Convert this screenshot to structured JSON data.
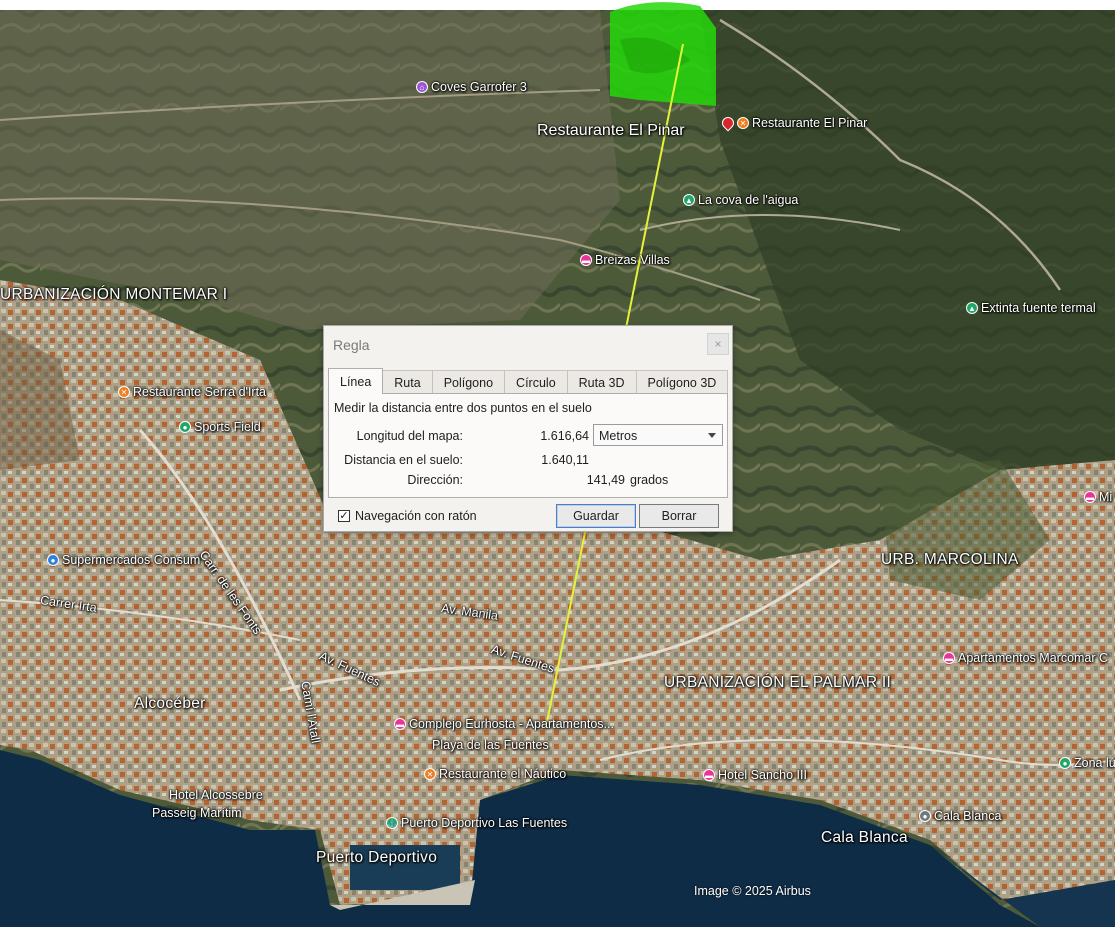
{
  "map": {
    "credit": "Image © 2025 Airbus",
    "colors": {
      "measure_line": "#e5f23a",
      "highlight_area": "#25d80a",
      "sea": "#0f2c46"
    },
    "labels": [
      {
        "id": "coves-garrofer",
        "text": "Coves Garrofer 3",
        "pin": "purple"
      },
      {
        "id": "restaurante-el-pinar-big",
        "text": "Restaurante El Pinar",
        "pin": ""
      },
      {
        "id": "restaurante-el-pinar",
        "text": "Restaurante El Pinar",
        "pin": "orange"
      },
      {
        "id": "cova-laigua",
        "text": "La cova de l'aigua",
        "pin": "green"
      },
      {
        "id": "breizas-villas",
        "text": "Breizas Villas",
        "pin": "pink"
      },
      {
        "id": "urb-montemar",
        "text": "URBANIZACIÓN MONTEMAR I",
        "pin": ""
      },
      {
        "id": "extinta-fuente",
        "text": "Extinta fuente termal",
        "pin": "green"
      },
      {
        "id": "restaurante-serra",
        "text": "Restaurante Serra d'Irta",
        "pin": "orange"
      },
      {
        "id": "sports-field",
        "text": "Sports Field",
        "pin": "green"
      },
      {
        "id": "supermercados",
        "text": "Supermercados Consum",
        "pin": "blue"
      },
      {
        "id": "carrer-fonts",
        "text": "Carr. de les Fonts",
        "pin": ""
      },
      {
        "id": "carrer-irta",
        "text": "Carrer Irta",
        "pin": ""
      },
      {
        "id": "av-manila",
        "text": "Av. Manila",
        "pin": ""
      },
      {
        "id": "av-fuentes-1",
        "text": "Av. Fuentes",
        "pin": ""
      },
      {
        "id": "av-fuentes-2",
        "text": "Av. Fuentes",
        "pin": ""
      },
      {
        "id": "urb-marcolina",
        "text": "URB. MARCOLINA",
        "pin": ""
      },
      {
        "id": "urb-palmar",
        "text": "URBANIZACIÓN EL PALMAR II",
        "pin": ""
      },
      {
        "id": "alcoceber",
        "text": "Alcocéber",
        "pin": ""
      },
      {
        "id": "cami-atall",
        "text": "Camí l'Atall",
        "pin": ""
      },
      {
        "id": "complejo",
        "text": "Complejo Eurhosta - Apartamentos...",
        "pin": "pink"
      },
      {
        "id": "playa-fuentes",
        "text": "Playa de las Fuentes",
        "pin": ""
      },
      {
        "id": "apart-marcomar",
        "text": "Apartamentos Marcomar C",
        "pin": "pink"
      },
      {
        "id": "restaurante-nautico",
        "text": "Restaurante el Náutico",
        "pin": "orange"
      },
      {
        "id": "hotel-sancho",
        "text": "Hotel Sancho III",
        "pin": "pink"
      },
      {
        "id": "zona-l",
        "text": "Zona lú",
        "pin": "green"
      },
      {
        "id": "hotel-alcossebre",
        "text": "Hotel Alcossebre",
        "pin": ""
      },
      {
        "id": "passeig",
        "text": "Passeig Marítim",
        "pin": ""
      },
      {
        "id": "puerto-fuentes",
        "text": "Puerto Deportivo Las Fuentes",
        "pin": "green"
      },
      {
        "id": "cala-blanca-pin",
        "text": "Cala Blanca",
        "pin": "grey"
      },
      {
        "id": "cala-blanca",
        "text": "Cala Blanca",
        "pin": ""
      },
      {
        "id": "puerto-deportivo",
        "text": "Puerto Deportivo",
        "pin": ""
      },
      {
        "id": "mi",
        "text": "Mi",
        "pin": "pink"
      }
    ]
  },
  "dialog": {
    "title": "Regla",
    "close_label": "×",
    "tabs": [
      "Línea",
      "Ruta",
      "Polígono",
      "Círculo",
      "Ruta 3D",
      "Polígono 3D"
    ],
    "active_tab": "Línea",
    "description": "Medir la distancia entre dos puntos en el suelo",
    "map_length_label": "Longitud del mapa:",
    "map_length_value": "1.616,64",
    "unit_select": "Metros",
    "ground_distance_label": "Distancia en el suelo:",
    "ground_distance_value": "1.640,11",
    "heading_label": "Dirección:",
    "heading_value": "141,49",
    "heading_unit": "grados",
    "mouse_nav_label": "Navegación con ratón",
    "mouse_nav_checked": true,
    "save_label": "Guardar",
    "clear_label": "Borrar"
  }
}
